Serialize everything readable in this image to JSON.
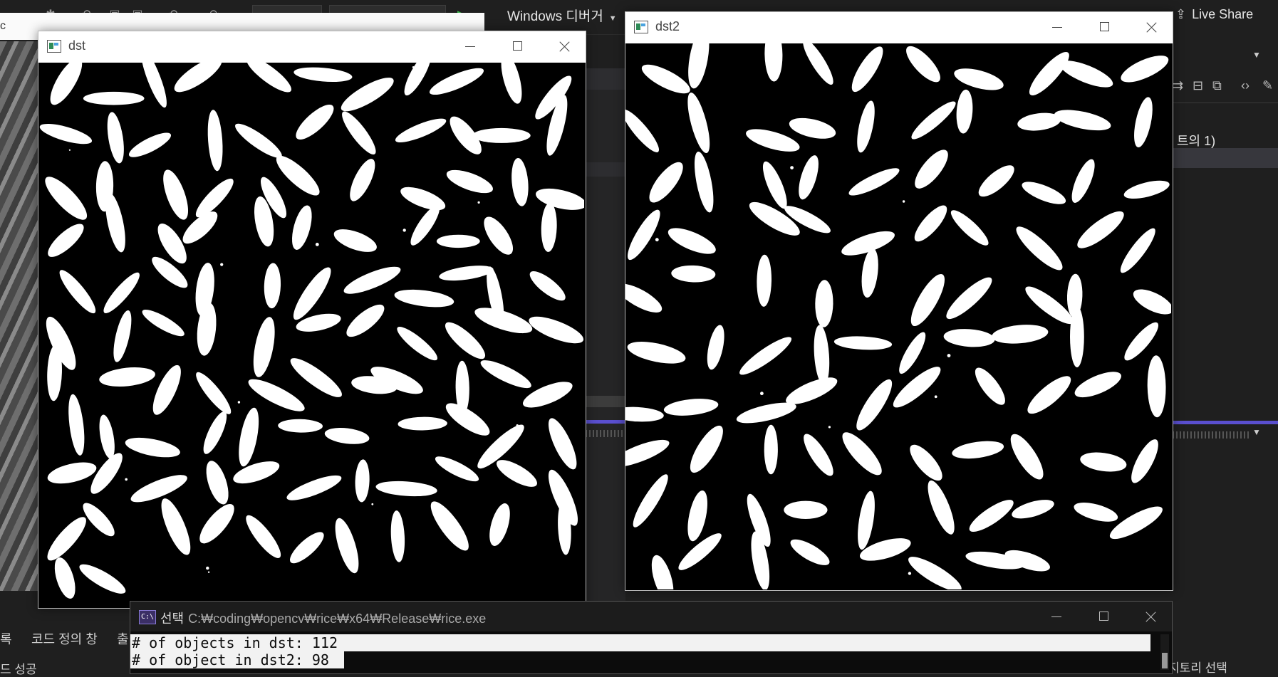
{
  "ide": {
    "debug_target": "Windows 디버거",
    "live_share": "Live Share",
    "partial_left_c": "c",
    "right_panel": {
      "project_label": "트의 1)"
    },
    "bottom_tabs": [
      "록",
      "코드 정의 창",
      "출"
    ],
    "bottom_status": "드 성공",
    "bottom_right_status": "지토리 선택"
  },
  "windows": [
    {
      "title": "dst"
    },
    {
      "title": "dst2"
    }
  ],
  "console": {
    "prefix": "선택",
    "path": "C:₩coding₩opencv₩rice₩x64₩Release₩rice.exe",
    "lines": [
      "# of objects in dst: 112",
      "# of object in dst2: 98"
    ],
    "icon_label": "C:\\"
  },
  "colors": {
    "background": "#1f1f1f",
    "accent_purple": "#5a4fcf",
    "run_green": "#3fb950"
  },
  "icons": [
    "window-app-icon",
    "minimize-icon",
    "maximize-icon",
    "close-icon",
    "console-icon",
    "live-share-icon",
    "run-icon"
  ]
}
